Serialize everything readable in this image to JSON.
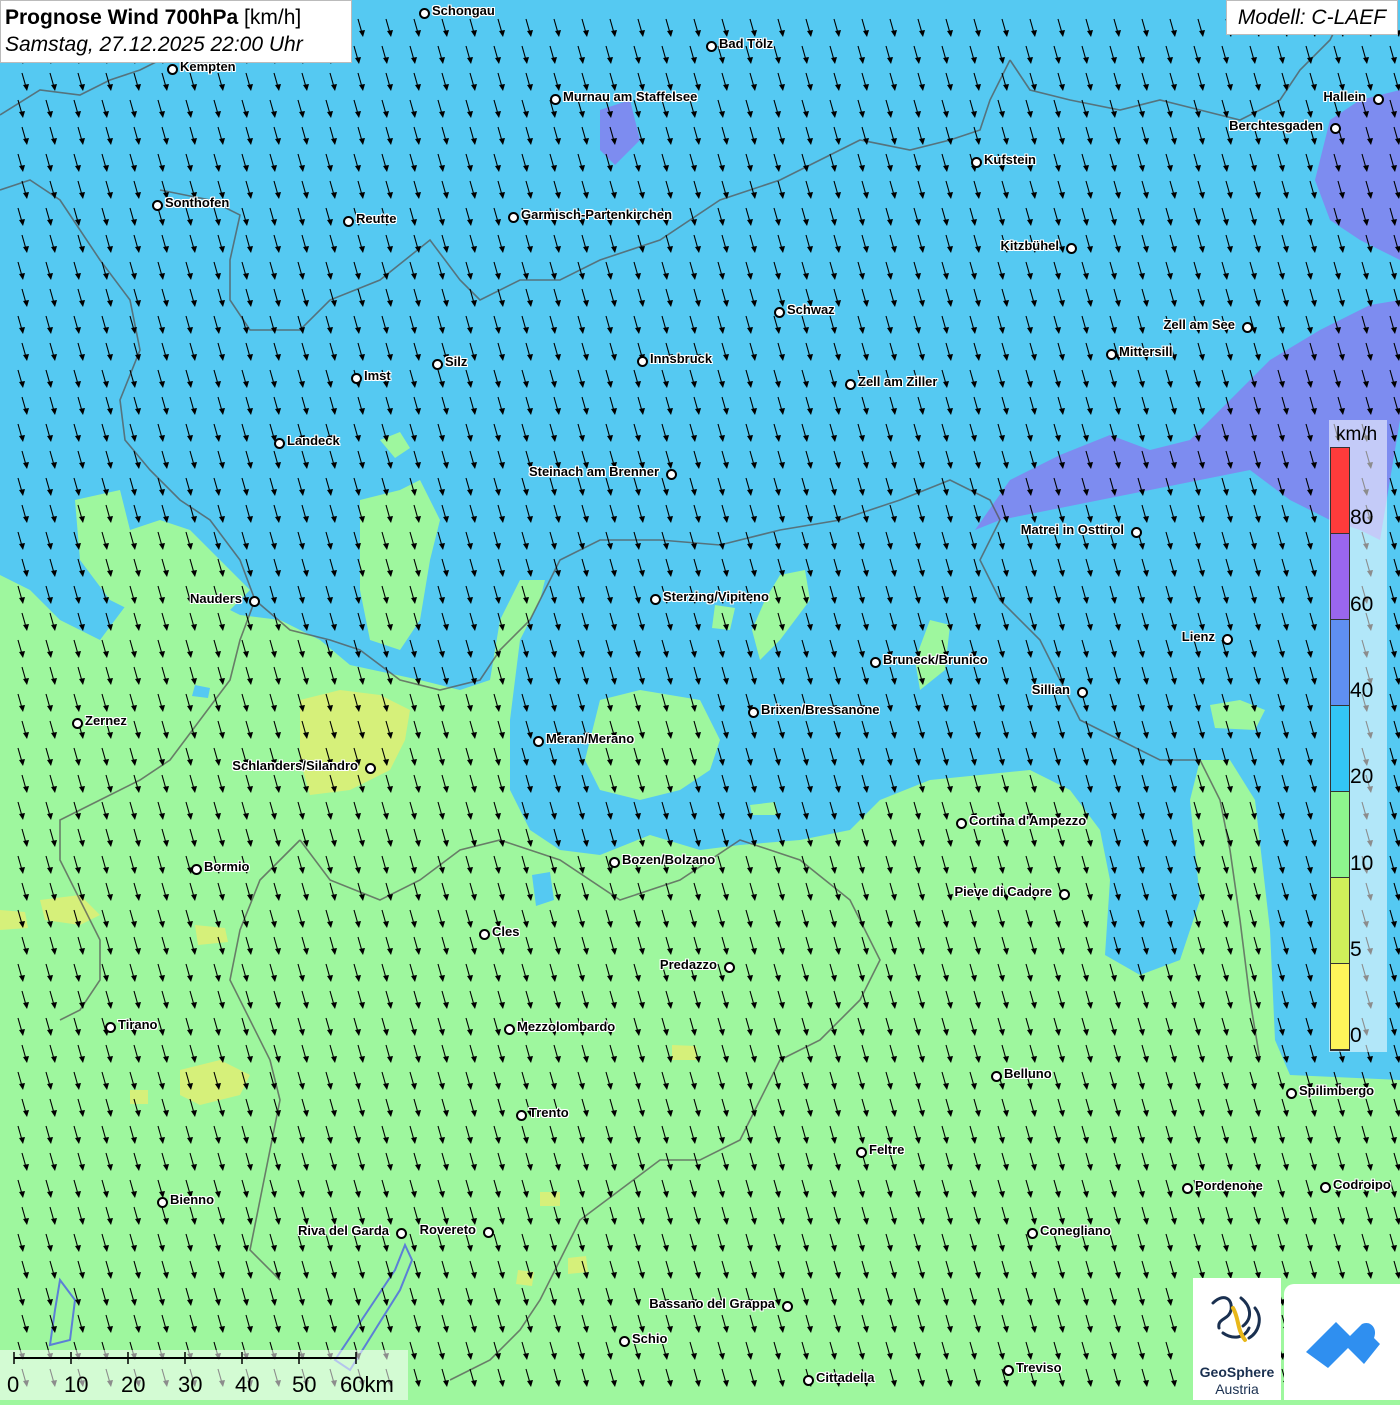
{
  "header": {
    "title_bold": "Prognose Wind 700hPa",
    "title_unit": "[km/h]",
    "datetime": "Samstag, 27.12.2025 22:00 Uhr"
  },
  "model": "Modell: C-LAEF",
  "legend": {
    "unit": "km/h",
    "labels": [
      "80",
      "60",
      "40",
      "20",
      "10",
      "5",
      "0"
    ],
    "colors": [
      "#ff3b3b",
      "#9a66ee",
      "#5f8ff2",
      "#33c6f4",
      "#8ef58e",
      "#cff05a",
      "#fff45a"
    ]
  },
  "scalebar": {
    "labels": [
      "0",
      "10",
      "20",
      "30",
      "40",
      "50",
      "60km"
    ]
  },
  "map": {
    "colors": {
      "blue": "#55c9f2",
      "green": "#9ef79e",
      "violet": "#7d8cf0",
      "yellow": "#d6f07a"
    },
    "wind_direction": "south-southwest arrows"
  },
  "cities": [
    {
      "name": "Schongau"
    },
    {
      "name": "Bad Tölz"
    },
    {
      "name": "Kempten"
    },
    {
      "name": "Murnau am Staffelsee"
    },
    {
      "name": "Hallein"
    },
    {
      "name": "Berchtesgaden"
    },
    {
      "name": "Kufstein"
    },
    {
      "name": "Sonthofen"
    },
    {
      "name": "Reutte"
    },
    {
      "name": "Garmisch-Partenkirchen"
    },
    {
      "name": "Kitzbühel"
    },
    {
      "name": "Schwaz"
    },
    {
      "name": "Zell am See"
    },
    {
      "name": "Innsbruck"
    },
    {
      "name": "Silz"
    },
    {
      "name": "Mittersill"
    },
    {
      "name": "Imst"
    },
    {
      "name": "Zell am Ziller"
    },
    {
      "name": "Landeck"
    },
    {
      "name": "Steinach am Brenner"
    },
    {
      "name": "Matrei in Osttirol"
    },
    {
      "name": "Nauders"
    },
    {
      "name": "Sterzing/Vipiteno"
    },
    {
      "name": "Lienz"
    },
    {
      "name": "Bruneck/Brunico"
    },
    {
      "name": "Sillian"
    },
    {
      "name": "Brixen/Bressanone"
    },
    {
      "name": "Zernez"
    },
    {
      "name": "Meran/Merano"
    },
    {
      "name": "Schlanders/Silandro"
    },
    {
      "name": "Cortina d'Ampezzo"
    },
    {
      "name": "Bozen/Bolzano"
    },
    {
      "name": "Bormio"
    },
    {
      "name": "Pieve di Cadore"
    },
    {
      "name": "Cles"
    },
    {
      "name": "Predazzo"
    },
    {
      "name": "Tirano"
    },
    {
      "name": "Mezzolombardo"
    },
    {
      "name": "Belluno"
    },
    {
      "name": "Spilimbergo"
    },
    {
      "name": "Trento"
    },
    {
      "name": "Feltre"
    },
    {
      "name": "Pordenone"
    },
    {
      "name": "Codroipo"
    },
    {
      "name": "Bienno"
    },
    {
      "name": "Riva del Garda"
    },
    {
      "name": "Rovereto"
    },
    {
      "name": "Conegliano"
    },
    {
      "name": "Bassano del Grappa"
    },
    {
      "name": "Schio"
    },
    {
      "name": "Treviso"
    },
    {
      "name": "Cittadella"
    }
  ],
  "logos": {
    "geosphere_line1": "GeoSphere",
    "geosphere_line2": "Austria"
  }
}
